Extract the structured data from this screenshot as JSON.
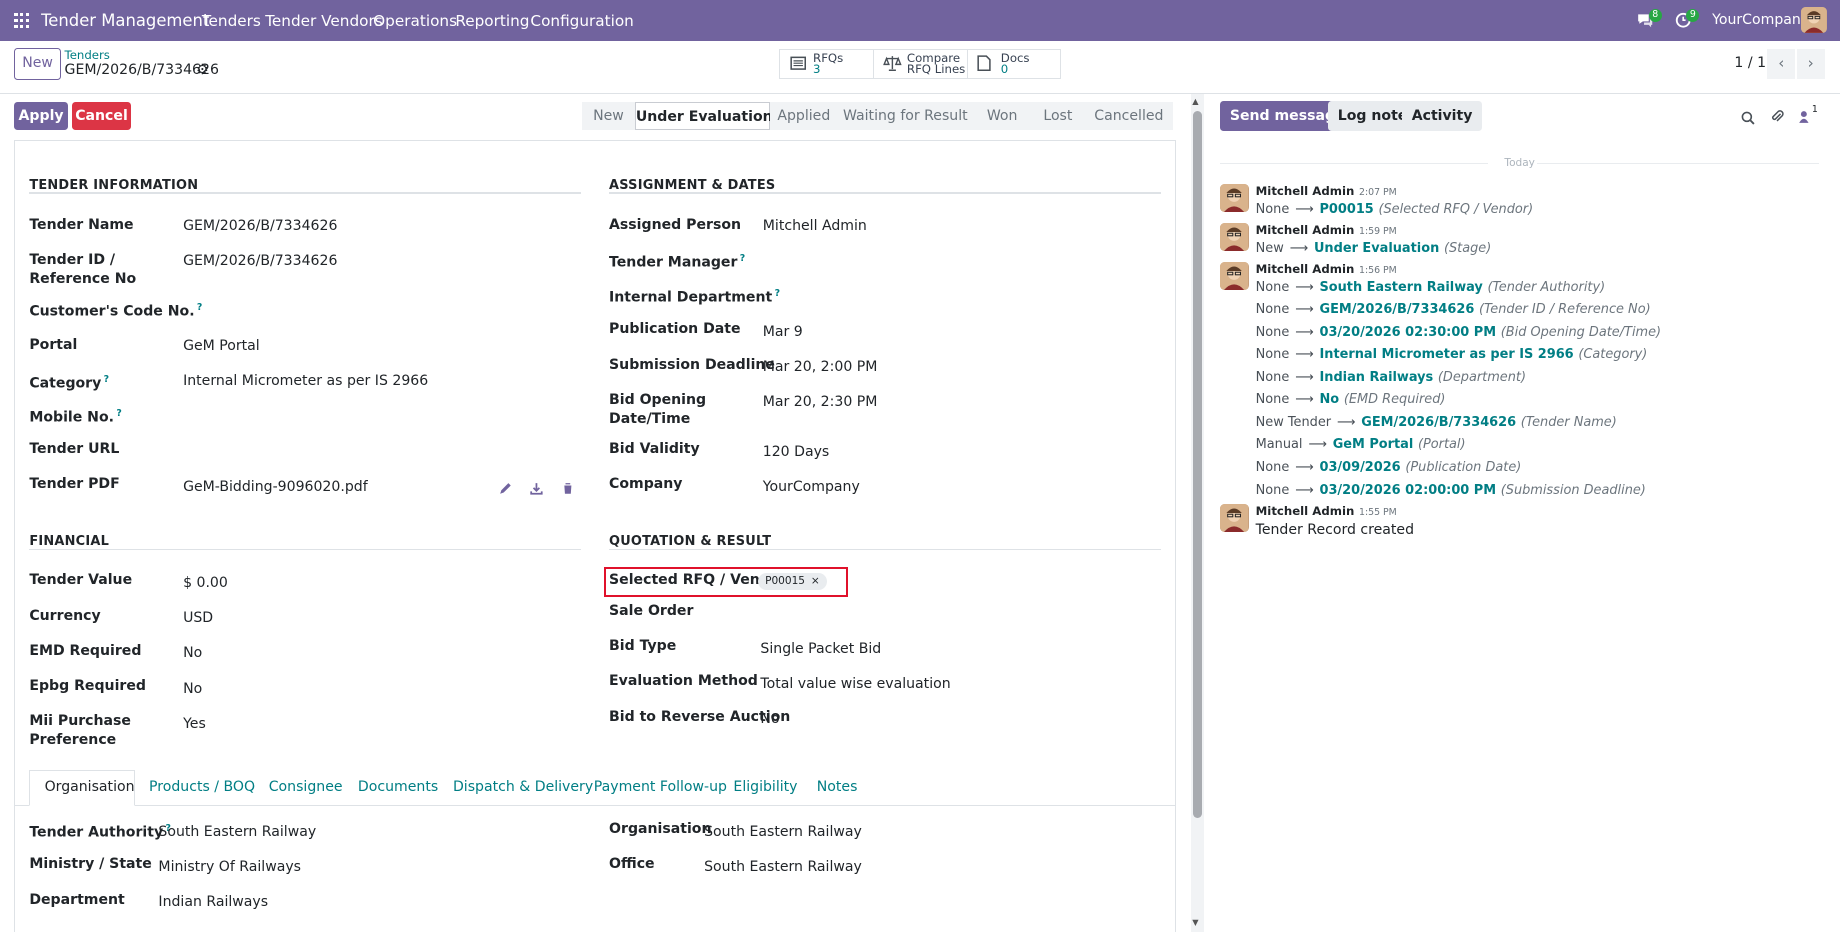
{
  "navbar": {
    "app_name": "Tender Management",
    "menu": [
      "Tenders",
      "Tender Vendors",
      "Operations",
      "Reporting",
      "Configuration"
    ],
    "messages_badge": "8",
    "activities_badge": "9",
    "company": "YourCompany"
  },
  "control": {
    "new_label": "New",
    "breadcrumb_parent": "Tenders",
    "record_name": "GEM/2026/B/7334626",
    "pager": "1 / 1",
    "smart_buttons": [
      {
        "label": "RFQs",
        "value": "3",
        "icon": "list-icon"
      },
      {
        "label": "Compare",
        "label2": "RFQ Lines",
        "icon": "scale-icon"
      },
      {
        "label": "Docs",
        "value": "0",
        "icon": "document-icon"
      }
    ]
  },
  "actions": {
    "apply": "Apply",
    "cancel": "Cancel"
  },
  "statusbar": [
    "New",
    "Under Evaluation",
    "Applied",
    "Waiting for Result",
    "Won",
    "Lost",
    "Cancelled"
  ],
  "status_current": "Under Evaluation",
  "sections": {
    "tender_info": "TENDER INFORMATION",
    "assignment": "ASSIGNMENT & DATES",
    "financial": "FINANCIAL",
    "quotation": "QUOTATION & RESULT"
  },
  "tender_info": {
    "tender_name_label": "Tender Name",
    "tender_name": "GEM/2026/B/7334626",
    "tender_id_label": "Tender ID / Reference No",
    "tender_id": "GEM/2026/B/7334626",
    "customer_code_label": "Customer's Code No.",
    "portal_label": "Portal",
    "portal": "GeM Portal",
    "category_label": "Category",
    "category": "Internal Micrometer as per IS 2966",
    "mobile_label": "Mobile No.",
    "url_label": "Tender URL",
    "pdf_label": "Tender PDF",
    "pdf": "GeM-Bidding-9096020.pdf"
  },
  "assignment": {
    "assigned_label": "Assigned Person",
    "assigned": "Mitchell Admin",
    "manager_label": "Tender Manager",
    "dept_label": "Internal Department",
    "pub_label": "Publication Date",
    "pub": "Mar 9",
    "deadline_label": "Submission Deadline",
    "deadline": "Mar 20, 2:00 PM",
    "bid_open_label": "Bid Opening Date/Time",
    "bid_open": "Mar 20, 2:30 PM",
    "validity_label": "Bid Validity",
    "validity": "120 Days",
    "company_label": "Company",
    "company": "YourCompany"
  },
  "financial": {
    "value_label": "Tender Value",
    "value": "$ 0.00",
    "currency_label": "Currency",
    "currency": "USD",
    "emd_label": "EMD Required",
    "emd": "No",
    "epbg_label": "Epbg Required",
    "epbg": "No",
    "mii_label": "Mii Purchase Preference",
    "mii": "Yes"
  },
  "quotation": {
    "rfq_label": "Selected RFQ / Vendor",
    "rfq_tag": "P00015",
    "sale_label": "Sale Order",
    "bid_type_label": "Bid Type",
    "bid_type": "Single Packet Bid",
    "eval_label": "Evaluation Method",
    "eval": "Total value wise evaluation",
    "reverse_label": "Bid to Reverse Auction",
    "reverse": "No"
  },
  "tabs": [
    "Organisation",
    "Products / BOQ",
    "Consignee",
    "Documents",
    "Dispatch & Delivery",
    "Payment Follow-up",
    "Eligibility",
    "Notes"
  ],
  "organisation": {
    "authority_label": "Tender Authority",
    "authority": "South Eastern Railway",
    "ministry_label": "Ministry / State",
    "ministry": "Ministry Of Railways",
    "department_label": "Department",
    "department": "Indian Railways",
    "org_label": "Organisation",
    "org": "South Eastern Railway",
    "office_label": "Office",
    "office": "South Eastern Railway"
  },
  "chatter": {
    "send_message": "Send message",
    "log_note": "Log note",
    "activity": "Activity",
    "followers_count": "1",
    "date_divider": "Today",
    "messages": [
      {
        "author": "Mitchell Admin",
        "time": "2:07 PM",
        "tracking": [
          {
            "old": "None",
            "new": "P00015",
            "field": "(Selected RFQ / Vendor)"
          }
        ]
      },
      {
        "author": "Mitchell Admin",
        "time": "1:59 PM",
        "tracking": [
          {
            "old": "New",
            "new": "Under Evaluation",
            "field": "(Stage)"
          }
        ]
      },
      {
        "author": "Mitchell Admin",
        "time": "1:56 PM",
        "tracking": [
          {
            "old": "None",
            "new": "South Eastern Railway",
            "field": "(Tender Authority)"
          },
          {
            "old": "None",
            "new": "GEM/2026/B/7334626",
            "field": "(Tender ID / Reference No)"
          },
          {
            "old": "None",
            "new": "03/20/2026 02:30:00 PM",
            "field": "(Bid Opening Date/Time)"
          },
          {
            "old": "None",
            "new": "Internal Micrometer as per IS 2966",
            "field": "(Category)"
          },
          {
            "old": "None",
            "new": "Indian Railways",
            "field": "(Department)"
          },
          {
            "old": "None",
            "new": "No",
            "field": "(EMD Required)"
          },
          {
            "old": "New Tender",
            "new": "GEM/2026/B/7334626",
            "field": "(Tender Name)"
          },
          {
            "old": "Manual",
            "new": "GeM Portal",
            "field": "(Portal)"
          },
          {
            "old": "None",
            "new": "03/09/2026",
            "field": "(Publication Date)"
          },
          {
            "old": "None",
            "new": "03/20/2026 02:00:00 PM",
            "field": "(Submission Deadline)"
          }
        ]
      },
      {
        "author": "Mitchell Admin",
        "time": "1:55 PM",
        "body": "Tender Record created"
      }
    ]
  },
  "colors": {
    "brand": "#71639e",
    "accent": "#017e84",
    "danger": "#dc3545",
    "highlight": "#e0112b"
  }
}
